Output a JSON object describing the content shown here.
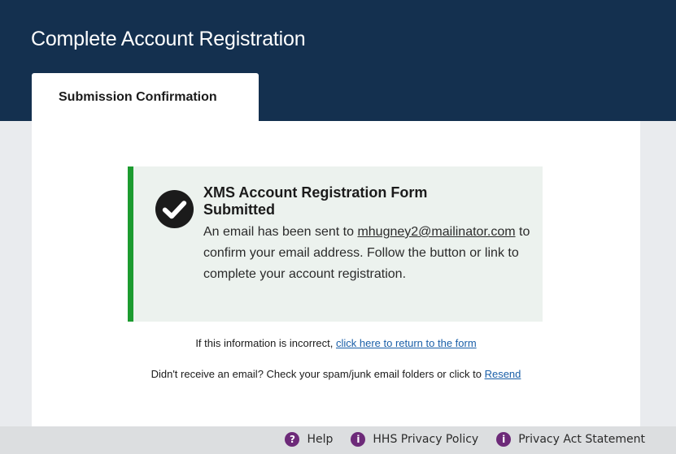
{
  "header": {
    "title": "Complete Account Registration"
  },
  "tab": {
    "label": "Submission Confirmation"
  },
  "alert": {
    "heading": "XMS Account Registration Form Submitted",
    "text_before_email": "An email has been sent to ",
    "email": "mhugney2@mailinator.com",
    "text_after_email": " to confirm your email address. Follow the button or link to complete your account registration."
  },
  "info": {
    "incorrect_text": "If this information is incorrect, ",
    "return_link": "click here to return to the form",
    "resend_text": "Didn't receive an email? Check your spam/junk email folders or click to ",
    "resend_link": "Resend"
  },
  "footer": {
    "links": [
      {
        "label": "Help",
        "icon": "help-icon",
        "glyph": "?"
      },
      {
        "label": "HHS Privacy Policy",
        "icon": "info-icon",
        "glyph": "i"
      },
      {
        "label": "Privacy Act Statement",
        "icon": "info-icon",
        "glyph": "i"
      }
    ]
  },
  "colors": {
    "header_bg": "#14304f",
    "alert_border": "#1c9b2f",
    "alert_bg": "#ecf2ee",
    "link": "#1a5fa8",
    "footer_icon": "#6d2a79"
  }
}
